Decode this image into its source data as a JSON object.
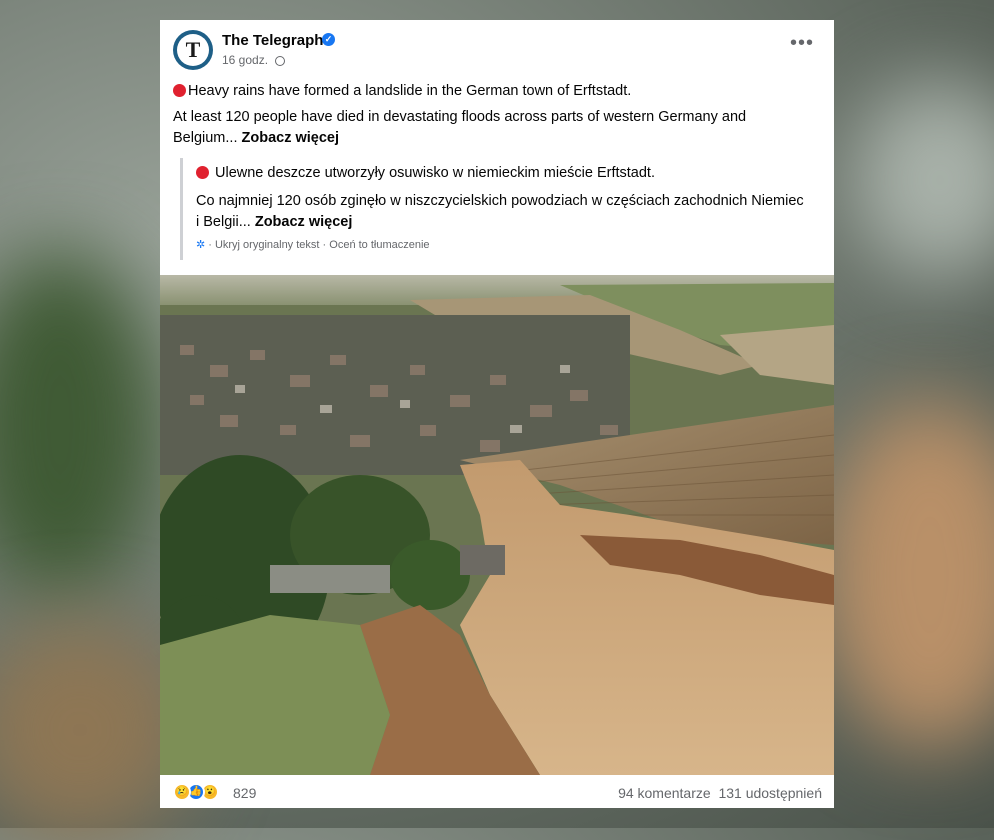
{
  "post": {
    "page_name": "The Telegraph",
    "time": "16 godz.",
    "avatar_letter": "T",
    "line1": "Heavy rains have formed a landslide in the German town of Erftstadt.",
    "line2": "At least 120 people have died in devastating floods across parts of western Germany and Belgium...",
    "see_more": "Zobacz więcej"
  },
  "translation": {
    "line1": "Ulewne deszcze utworzyły osuwisko w niemieckim mieście Erftstadt.",
    "line2": "Co najmniej 120 osób zginęło w niszczycielskich powodziach w częściach zachodnich Niemiec i Belgii...",
    "see_more": "Zobacz więcej",
    "hide_original": "· Ukryj oryginalny tekst",
    "rate": "· Oceń to tłumaczenie"
  },
  "footer": {
    "reaction_count": "829",
    "comments": "94 komentarze",
    "shares": "131 udostępnień"
  },
  "colors": {
    "accent": "#1877f2",
    "red_dot": "#e0212f"
  }
}
